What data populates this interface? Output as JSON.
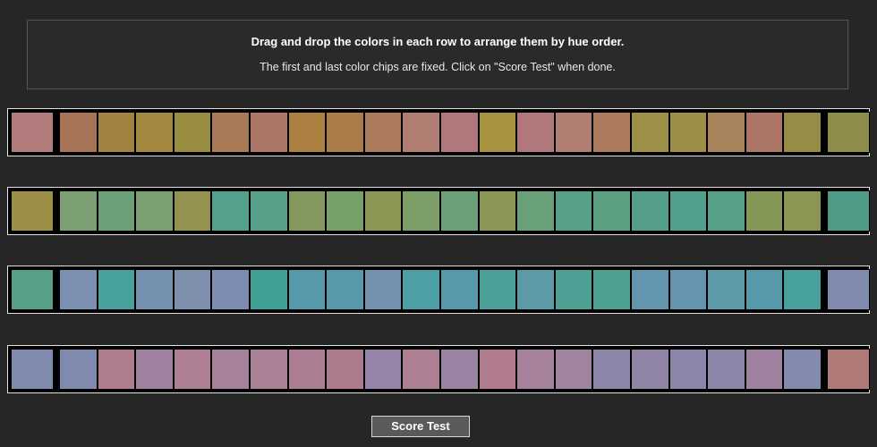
{
  "instructions": {
    "primary": "Drag and drop the colors in each row to arrange them by hue order.",
    "secondary": "The first and last color chips are fixed. Click on \"Score Test\" when done."
  },
  "controls": {
    "score_test_label": "Score Test"
  },
  "theme": {
    "page_background": "#262626",
    "panel_background": "#2a2a2a",
    "panel_border": "#555555",
    "row_border": "#e2e2e2",
    "row_background": "#000000",
    "text_primary": "#ffffff",
    "text_secondary": "#e8e8e8",
    "button_background": "#5a5a5a",
    "button_border": "#d8d8d8"
  },
  "rows": [
    {
      "id": "hue-row-1",
      "chip_count": 22,
      "fixed_first": "#b27c7c",
      "fixed_last": "#8d8c4b",
      "chips": [
        "#a87458",
        "#a3823f",
        "#a3893f",
        "#978c3f",
        "#a87a55",
        "#ab7665",
        "#ab8041",
        "#aa7c4a",
        "#ab7a5a",
        "#b07d72",
        "#b0787b",
        "#a89240",
        "#b0787b",
        "#b07d72",
        "#ab7a5a",
        "#9d8f45",
        "#9a8f45",
        "#a8825a",
        "#ab7665",
        "#978c45"
      ]
    },
    {
      "id": "hue-row-2",
      "chip_count": 22,
      "fixed_first": "#9b8f45",
      "fixed_last": "#4f9a87",
      "chips": [
        "#7d9f74",
        "#6ba079",
        "#7b9f72",
        "#93934f",
        "#55a08d",
        "#57a08a",
        "#83985f",
        "#78a069",
        "#8b9554",
        "#7d9e66",
        "#6ba079",
        "#8a9655",
        "#68a079",
        "#55a087",
        "#5aa081",
        "#559f8a",
        "#50a08d",
        "#55a087",
        "#859757",
        "#8b9554"
      ]
    },
    {
      "id": "hue-row-3",
      "chip_count": 22,
      "fixed_first": "#55a087",
      "fixed_last": "#8089ae",
      "chips": [
        "#7b90b0",
        "#48a09a",
        "#7492b0",
        "#7e8fad",
        "#7d8cb0",
        "#41a093",
        "#5599ab",
        "#5798aa",
        "#7491b0",
        "#4c9fa5",
        "#5998ab",
        "#4ba09a",
        "#5d9aa8",
        "#4ea094",
        "#4ca090",
        "#6495ae",
        "#6595ae",
        "#5c9aa8",
        "#5699ab",
        "#48a09a"
      ]
    },
    {
      "id": "hue-row-4",
      "chip_count": 22,
      "fixed_first": "#8089ae",
      "fixed_last": "#b07a79",
      "chips": [
        "#8089ae",
        "#b07d8c",
        "#a0819f",
        "#ae7e93",
        "#a6819b",
        "#aa8096",
        "#ad7d93",
        "#ae7b8e",
        "#9584a7",
        "#ae7e93",
        "#9b83a3",
        "#b07b8c",
        "#a6819b",
        "#a0849f",
        "#8a87a9",
        "#9085a7",
        "#8a86a9",
        "#8b87a9",
        "#a0819f",
        "#8489ae"
      ]
    }
  ]
}
